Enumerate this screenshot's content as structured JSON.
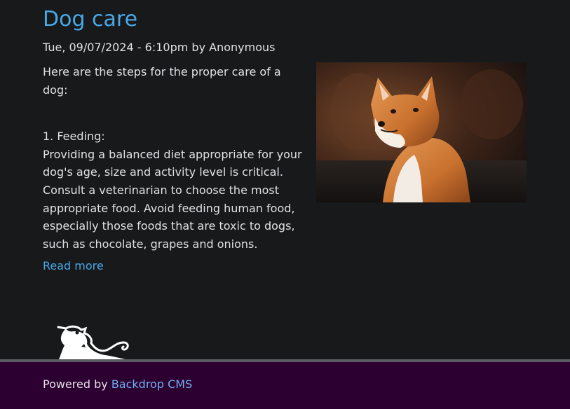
{
  "article": {
    "title": "Dog care",
    "meta": "Tue, 09/07/2024 - 6:10pm by Anonymous",
    "intro": "Here are the steps for the proper care of a dog:",
    "section_heading": "1. Feeding:",
    "section_body": "Providing a balanced diet appropriate for your dog's age, size and activity level is critical. Consult a veterinarian to choose the most appropriate food. Avoid feeding human food, especially those foods that are toxic to dogs, such as chocolate, grapes and onions.",
    "read_more": "Read more",
    "image_icon": "dog-photo"
  },
  "footer": {
    "powered_by": "Powered by",
    "cms_link": "Backdrop CMS",
    "mascot_icon": "backdrop-dragon-logo"
  },
  "colors": {
    "background": "#17191b",
    "link": "#4aa8e6",
    "footer_background": "#2c0030",
    "footer_rule": "#5a5d61"
  }
}
